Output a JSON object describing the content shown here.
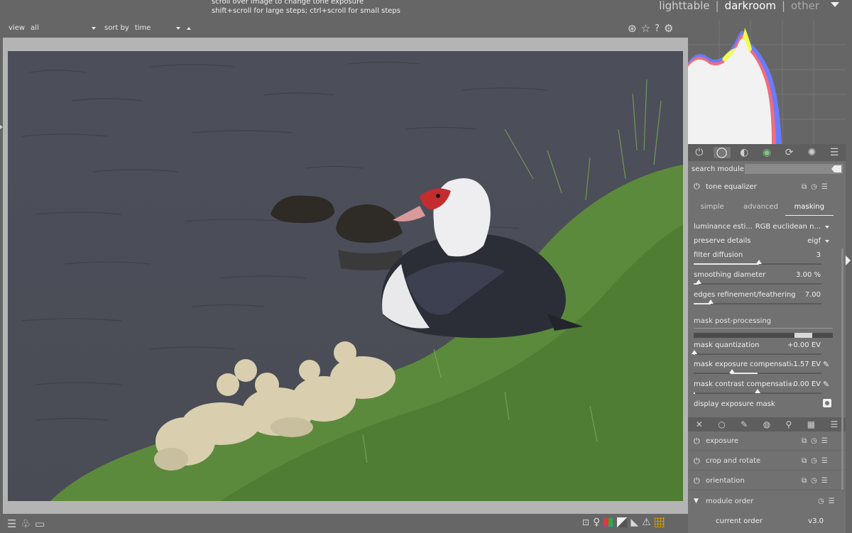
{
  "hint": {
    "line1": "scroll over image to change tone exposure",
    "line2": "shift+scroll for large steps; ctrl+scroll for small steps"
  },
  "views": {
    "lighttable": "lighttable",
    "darkroom": "darkroom",
    "other": "other",
    "sep": "|"
  },
  "filterbar": {
    "view_label": "view",
    "view_value": "all",
    "sort_label": "sort by",
    "sort_value": "time"
  },
  "top_icons": [
    "color-picker-icon",
    "star-icon",
    "help-icon",
    "gear-icon"
  ],
  "histogram": {
    "colors": {
      "red": "#ff6b6b",
      "green": "#f0ff50",
      "blue": "#6a7bff",
      "white": "#f2f2f2"
    }
  },
  "module_tabs": [
    "power-icon",
    "circle-icon",
    "gradient-icon",
    "color-icon",
    "correct-icon",
    "effect-icon",
    "menu-icon"
  ],
  "search": {
    "label": "search module",
    "placeholder": ""
  },
  "tone_equalizer": {
    "title": "tone equalizer",
    "tabs": [
      "simple",
      "advanced",
      "masking"
    ],
    "active_tab": "masking",
    "luminance_label": "luminance esti...",
    "luminance_value": "RGB euclidean n...",
    "preserve_label": "preserve details",
    "preserve_value": "eigf",
    "filter_diffusion_label": "filter diffusion",
    "filter_diffusion_value": "3",
    "smoothing_label": "smoothing diameter",
    "smoothing_value": "3.00 %",
    "edges_label": "edges refinement/feathering",
    "edges_value": "7.00",
    "post_label": "mask post-processing",
    "quant_label": "mask quantization",
    "quant_value": "+0.00 EV",
    "exp_comp_label": "mask exposure compensati...",
    "exp_comp_value": "-1.57 EV",
    "contrast_label": "mask contrast compensati...",
    "contrast_value": "+0.00 EV",
    "display_mask_label": "display exposure mask"
  },
  "quick_icons": [
    "reset-icon",
    "circle-icon",
    "brush-icon",
    "tone-icon",
    "lens-icon",
    "pattern-icon",
    "menu-icon"
  ],
  "modules": [
    {
      "name": "exposure"
    },
    {
      "name": "crop and rotate"
    },
    {
      "name": "orientation"
    },
    {
      "name": "module order"
    }
  ],
  "module_order": {
    "label": "current order",
    "value": "v3.0"
  }
}
